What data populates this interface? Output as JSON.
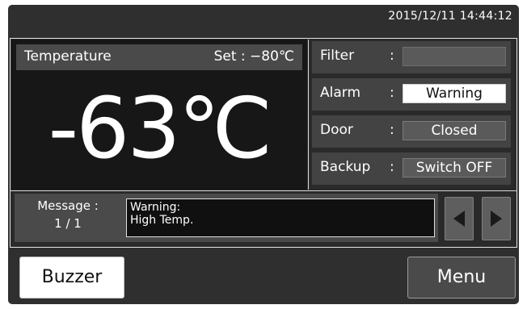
{
  "datetime": "2015/12/11  14:44:12",
  "temperature": {
    "header_label": "Temperature",
    "set_text": "Set :  −80℃",
    "current": "-63℃"
  },
  "status": [
    {
      "label": "Filter",
      "value": ""
    },
    {
      "label": "Alarm",
      "value": "Warning"
    },
    {
      "label": "Door",
      "value": "Closed"
    },
    {
      "label": "Backup",
      "value": "Switch OFF"
    }
  ],
  "status_separator": ":",
  "message": {
    "label": "Message :",
    "counter": "1 / 1",
    "line1": "Warning:",
    "line2": "High Temp."
  },
  "nav": {
    "prev_icon": "triangle-left-icon",
    "next_icon": "triangle-right-icon"
  },
  "buttons": {
    "buzzer": "Buzzer",
    "menu": "Menu"
  }
}
